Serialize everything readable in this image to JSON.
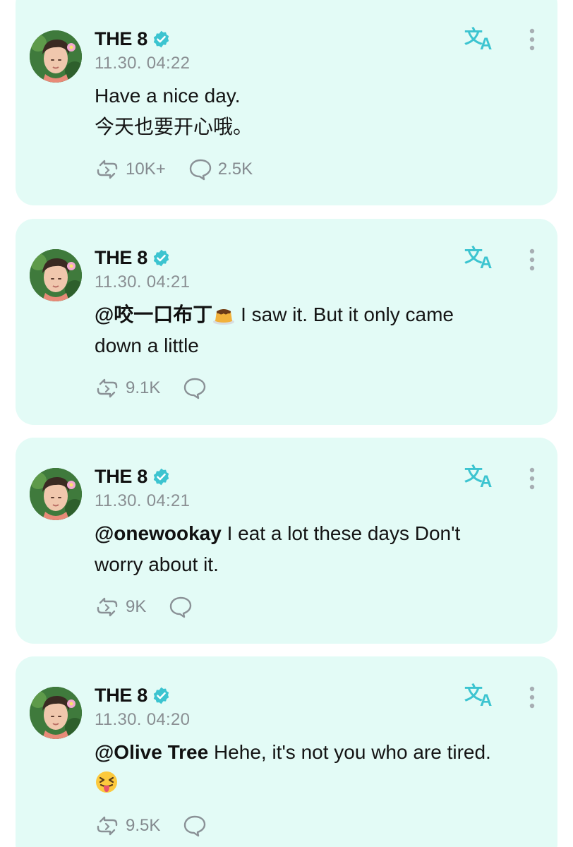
{
  "accent_color": "#3cc4d0",
  "card_background": "#e3fbf6",
  "posts": [
    {
      "author": "THE 8",
      "timestamp": "11.30. 04:22",
      "mention": "",
      "text_line1": "Have a nice day.",
      "text_line2": "今天也要开心哦。",
      "emoji": "",
      "reposts": "10K+",
      "comments": "2.5K"
    },
    {
      "author": "THE 8",
      "timestamp": "11.30. 04:21",
      "mention": "@咬一口布丁",
      "emoji": "pudding-emoji",
      "text_line1": " I saw it. But it only came",
      "text_line2": "down a little",
      "reposts": "9.1K",
      "comments": ""
    },
    {
      "author": "THE 8",
      "timestamp": "11.30. 04:21",
      "mention": "@onewookay",
      "text_line1": " I eat a lot these days Don't",
      "text_line2": "worry about it.",
      "emoji": "",
      "reposts": "9K",
      "comments": ""
    },
    {
      "author": "THE 8",
      "timestamp": "11.30. 04:20",
      "mention": "@Olive Tree",
      "text_line1": " Hehe, it's not you who are tired.",
      "text_line2": "",
      "emoji": "squinting-tongue-emoji",
      "reposts": "9.5K",
      "comments": ""
    }
  ],
  "icons": {
    "verified": "verified-badge-icon",
    "translate": "translate-icon",
    "more": "more-vertical-icon",
    "repost": "repost-icon",
    "comment": "comment-icon"
  }
}
